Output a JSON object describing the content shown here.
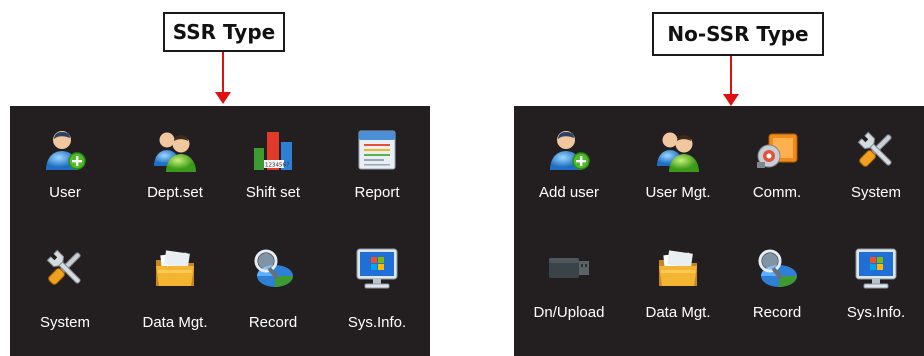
{
  "panels": [
    {
      "title": "SSR Type",
      "items": [
        {
          "label": "User",
          "icon": "user-add-icon"
        },
        {
          "label": "Dept.set",
          "icon": "users-group-icon"
        },
        {
          "label": "Shift set",
          "icon": "shift-chart-icon"
        },
        {
          "label": "Report",
          "icon": "report-icon"
        },
        {
          "label": "System",
          "icon": "tools-icon"
        },
        {
          "label": "Data Mgt.",
          "icon": "folder-icon"
        },
        {
          "label": "Record",
          "icon": "record-icon"
        },
        {
          "label": "Sys.Info.",
          "icon": "monitor-icon"
        }
      ]
    },
    {
      "title": "No-SSR Type",
      "items": [
        {
          "label": "Add user",
          "icon": "user-add-icon"
        },
        {
          "label": "User Mgt.",
          "icon": "users-group-icon"
        },
        {
          "label": "Comm.",
          "icon": "comm-icon"
        },
        {
          "label": "System",
          "icon": "tools-icon"
        },
        {
          "label": "Dn/Upload",
          "icon": "usb-drive-icon"
        },
        {
          "label": "Data Mgt.",
          "icon": "folder-icon"
        },
        {
          "label": "Record",
          "icon": "record-icon"
        },
        {
          "label": "Sys.Info.",
          "icon": "monitor-icon"
        }
      ]
    }
  ],
  "colors": {
    "screen_bg": "#231f20",
    "arrow": "#e01010",
    "label_text": "#ffffff"
  }
}
